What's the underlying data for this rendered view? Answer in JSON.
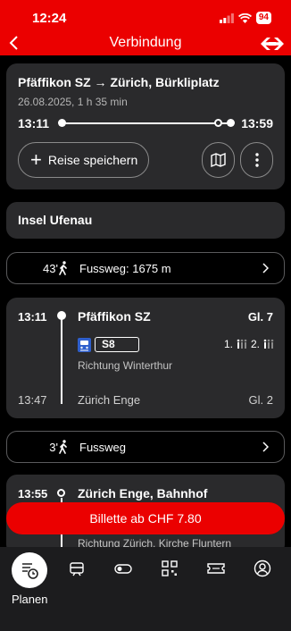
{
  "status": {
    "time": "12:24",
    "battery": "94"
  },
  "nav": {
    "title": "Verbindung"
  },
  "summary": {
    "route": "Pfäffikon SZ → Zürich, Bürkliplatz",
    "meta": "26.08.2025, 1 h 35 min",
    "departure": "13:11",
    "arrival": "13:59",
    "save_label": "Reise speichern"
  },
  "stop": {
    "title": "Insel Ufenau"
  },
  "walk1": {
    "minutes": "43'",
    "text": "Fussweg: 1675 m"
  },
  "leg1": {
    "departure": "13:11",
    "from": "Pfäffikon SZ",
    "platform_from": "Gl. 7",
    "line": "S8",
    "first_class": "1.",
    "second_class": "2.",
    "direction": "Richtung Winterthur",
    "arrival": "13:47",
    "to": "Zürich Enge",
    "platform_to": "Gl. 2"
  },
  "walk2": {
    "minutes": "3'",
    "text": "Fussweg"
  },
  "leg2": {
    "departure": "13:55",
    "from": "Zürich Enge, Bahnhof",
    "direction": "Richtung Zürich, Kirche Fluntern"
  },
  "ticket": {
    "label": "Billette ab CHF 7.80"
  },
  "tabs": {
    "active_label": "Planen"
  },
  "colors": {
    "brand": "#eb0000",
    "card": "#2a2a2c",
    "background": "#000000"
  }
}
